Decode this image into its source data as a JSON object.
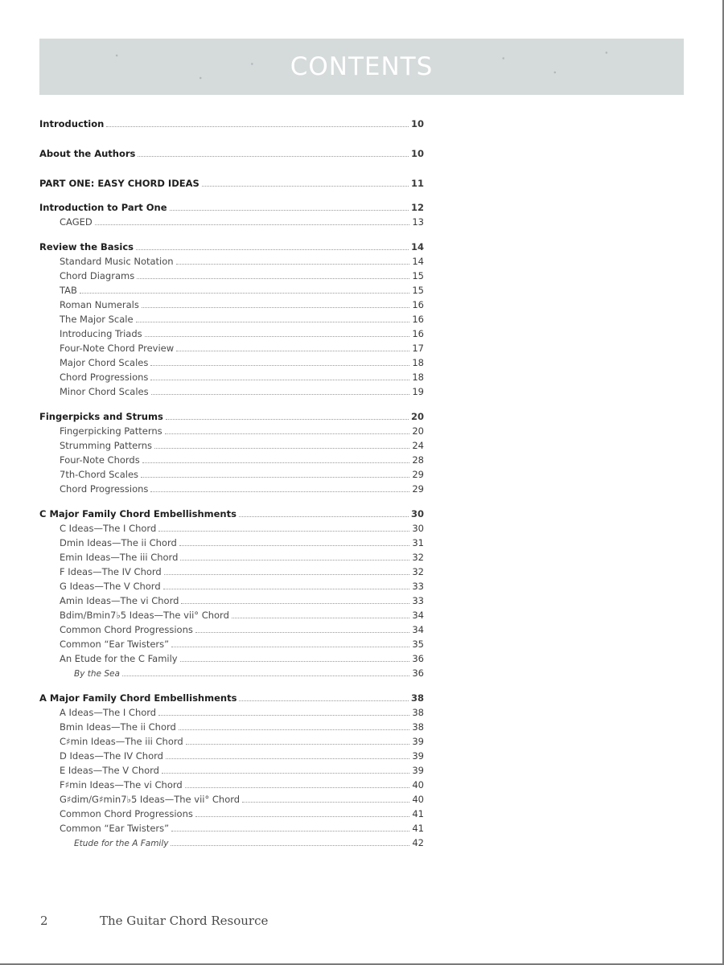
{
  "header": {
    "title": "CONTENTS"
  },
  "toc": [
    {
      "label": "Introduction",
      "page": "10",
      "level": 0
    },
    {
      "label": "About the Authors",
      "page": "10",
      "level": 0
    },
    {
      "label": "PART ONE: EASY CHORD IDEAS",
      "page": "11",
      "level": 0
    },
    {
      "label": "Introduction to Part One",
      "page": "12",
      "level": 0
    },
    {
      "label": "CAGED",
      "page": "13",
      "level": 1
    },
    {
      "label": "Review the Basics",
      "page": "14",
      "level": 0
    },
    {
      "label": "Standard Music Notation",
      "page": "14",
      "level": 1
    },
    {
      "label": "Chord Diagrams",
      "page": "15",
      "level": 1
    },
    {
      "label": "TAB",
      "page": "15",
      "level": 1
    },
    {
      "label": "Roman Numerals",
      "page": "16",
      "level": 1
    },
    {
      "label": "The Major Scale",
      "page": "16",
      "level": 1
    },
    {
      "label": "Introducing Triads",
      "page": "16",
      "level": 1
    },
    {
      "label": "Four-Note Chord Preview",
      "page": "17",
      "level": 1
    },
    {
      "label": "Major Chord Scales",
      "page": "18",
      "level": 1
    },
    {
      "label": "Chord Progressions",
      "page": "18",
      "level": 1
    },
    {
      "label": "Minor Chord Scales",
      "page": "19",
      "level": 1
    },
    {
      "label": "Fingerpicks and Strums",
      "page": "20",
      "level": 0
    },
    {
      "label": "Fingerpicking Patterns",
      "page": "20",
      "level": 1
    },
    {
      "label": "Strumming Patterns",
      "page": "24",
      "level": 1
    },
    {
      "label": "Four-Note Chords",
      "page": "28",
      "level": 1
    },
    {
      "label": "7th-Chord Scales",
      "page": "29",
      "level": 1
    },
    {
      "label": "Chord Progressions",
      "page": "29",
      "level": 1
    },
    {
      "label": "C Major Family Chord Embellishments",
      "page": "30",
      "level": 0
    },
    {
      "label": "C Ideas—The I Chord",
      "page": "30",
      "level": 1
    },
    {
      "label": "Dmin Ideas—The ii Chord",
      "page": "31",
      "level": 1
    },
    {
      "label": "Emin Ideas—The iii Chord",
      "page": "32",
      "level": 1
    },
    {
      "label": "F Ideas—The IV Chord",
      "page": "32",
      "level": 1
    },
    {
      "label": "G Ideas—The V Chord",
      "page": "33",
      "level": 1
    },
    {
      "label": "Amin Ideas—The vi Chord",
      "page": "33",
      "level": 1
    },
    {
      "label": "Bdim/Bmin7♭5 Ideas—The vii° Chord",
      "page": "34",
      "level": 1
    },
    {
      "label": "Common Chord Progressions",
      "page": "34",
      "level": 1
    },
    {
      "label": "Common “Ear Twisters”",
      "page": "35",
      "level": 1
    },
    {
      "label": "An Etude for the C Family",
      "page": "36",
      "level": 1
    },
    {
      "label": "By the Sea",
      "page": "36",
      "level": 2
    },
    {
      "label": "A Major Family Chord Embellishments",
      "page": "38",
      "level": 0
    },
    {
      "label": "A Ideas—The I Chord",
      "page": "38",
      "level": 1
    },
    {
      "label": "Bmin Ideas—The ii Chord",
      "page": "38",
      "level": 1
    },
    {
      "label": "C♯min Ideas—The iii Chord",
      "page": "39",
      "level": 1
    },
    {
      "label": "D Ideas—The IV Chord",
      "page": "39",
      "level": 1
    },
    {
      "label": "E Ideas—The V Chord",
      "page": "39",
      "level": 1
    },
    {
      "label": "F♯min Ideas—The vi Chord",
      "page": "40",
      "level": 1
    },
    {
      "label": "G♯dim/G♯min7♭5 Ideas—The vii° Chord",
      "page": "40",
      "level": 1
    },
    {
      "label": "Common Chord Progressions",
      "page": "41",
      "level": 1
    },
    {
      "label": "Common “Ear Twisters”",
      "page": "41",
      "level": 1
    },
    {
      "label": "Etude for the A Family",
      "page": "42",
      "level": 2
    }
  ],
  "footer": {
    "page_number": "2",
    "book_title": "The Guitar Chord Resource"
  }
}
